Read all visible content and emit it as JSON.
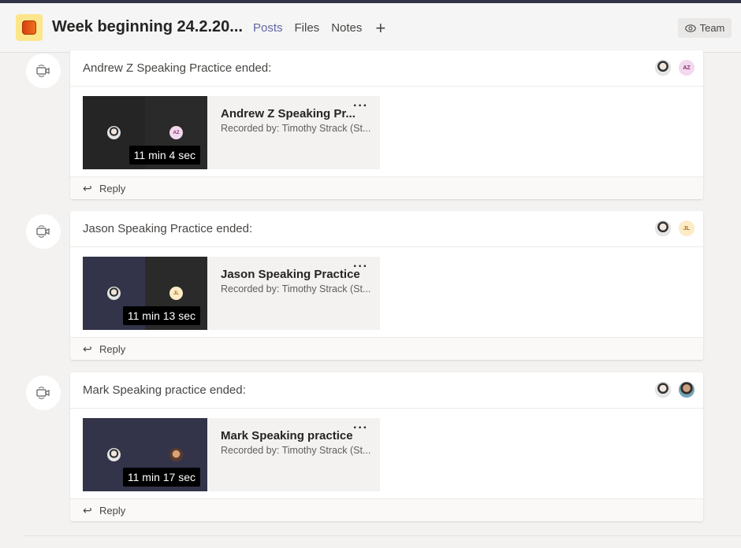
{
  "header": {
    "title": "Week beginning 24.2.20...",
    "tabs": [
      {
        "label": "Posts",
        "active": true
      },
      {
        "label": "Files",
        "active": false
      },
      {
        "label": "Notes",
        "active": false
      }
    ],
    "add_tab_label": "+",
    "team_button_label": "Team",
    "accent_color": "#6264a7"
  },
  "posts": [
    {
      "title": "Andrew Z Speaking Practice ended:",
      "participants": [
        "photo",
        "AZ"
      ],
      "recording": {
        "title": "Andrew Z Speaking Pr...",
        "recorded_by": "Recorded by: Timothy Strack (St...",
        "duration": "11 min 4 sec",
        "tiles": [
          "photo",
          "AZ"
        ]
      },
      "reply_label": "Reply"
    },
    {
      "title": "Jason Speaking Practice ended:",
      "participants": [
        "photo",
        "JL"
      ],
      "recording": {
        "title": "Jason Speaking Practice",
        "recorded_by": "Recorded by: Timothy Strack (St...",
        "duration": "11 min 13 sec",
        "tiles": [
          "photo",
          "JL"
        ]
      },
      "reply_label": "Reply"
    },
    {
      "title": "Mark Speaking practice ended:",
      "participants": [
        "photo",
        "photo"
      ],
      "recording": {
        "title": "Mark Speaking practice",
        "recorded_by": "Recorded by: Timothy Strack (St...",
        "duration": "11 min 17 sec",
        "tiles": [
          "photo",
          "photo"
        ]
      },
      "reply_label": "Reply"
    }
  ],
  "icons": {
    "post_icon": "video-camera-icon",
    "more_icon": "more-options-icon",
    "reply_icon": "reply-arrow-icon",
    "team_icon": "eye-icon"
  }
}
